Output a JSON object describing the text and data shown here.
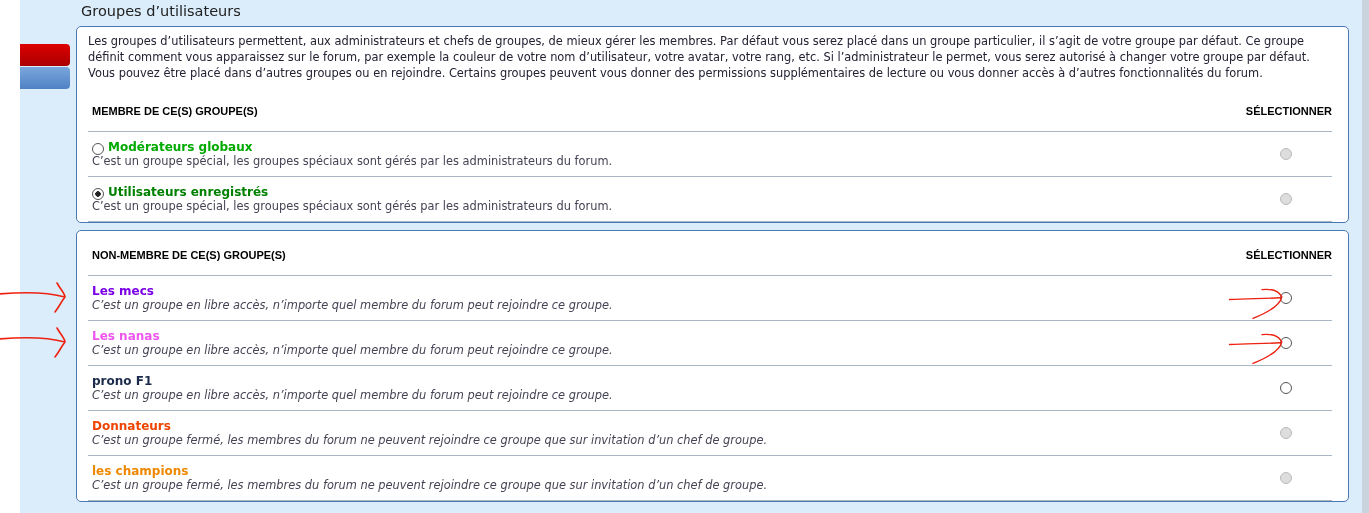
{
  "title": "Groupes d’utilisateurs",
  "intro": "Les groupes d’utilisateurs permettent, aux administrateurs et chefs de groupes, de mieux gérer les membres. Par défaut vous serez placé dans un groupe particulier, il s’agit de votre groupe par défaut. Ce groupe définit comment vous apparaissez sur le forum, par exemple la couleur de votre nom d’utilisateur, votre avatar, votre rang, etc. Si l’administrateur le permet, vous serez autorisé à changer votre groupe par défaut. Vous pouvez être placé dans d’autres groupes ou en rejoindre. Certains groupes peuvent vous donner des permissions supplémentaires de lecture ou vous donner accès à d’autres fonctionnalités du forum.",
  "sections": [
    {
      "heading": "MEMBRE DE CE(S) GROUPE(S)",
      "select_heading": "SÉLECTIONNER",
      "groups": [
        {
          "name": "Modérateurs globaux",
          "color": "#00aa00",
          "description": "C’est un groupe spécial, les groupes spéciaux sont gérés par les administrateurs du forum.",
          "kind": "member",
          "default": false,
          "select_disabled": true,
          "marked": false
        },
        {
          "name": "Utilisateurs enregistrés",
          "color": "#008000",
          "description": "C’est un groupe spécial, les groupes spéciaux sont gérés par les administrateurs du forum.",
          "kind": "member",
          "default": true,
          "select_disabled": true,
          "marked": false
        }
      ]
    },
    {
      "heading": "NON-MEMBRE DE CE(S) GROUPE(S)",
      "select_heading": "SÉLECTIONNER",
      "groups": [
        {
          "name": "Les mecs",
          "color": "#7a00e6",
          "description": "C’est un groupe en libre accès, n’importe quel membre du forum peut rejoindre ce groupe.",
          "kind": "other",
          "select_disabled": false,
          "marked": true
        },
        {
          "name": "Les nanas",
          "color": "#ee55ee",
          "description": "C’est un groupe en libre accès, n’importe quel membre du forum peut rejoindre ce groupe.",
          "kind": "other",
          "select_disabled": false,
          "marked": true
        },
        {
          "name": "prono F1",
          "color": "#1a2a4a",
          "description": "C’est un groupe en libre accès, n’importe quel membre du forum peut rejoindre ce groupe.",
          "kind": "other",
          "select_disabled": false,
          "marked": false
        },
        {
          "name": "Donnateurs",
          "color": "#ee4400",
          "description": "C’est un groupe fermé, les membres du forum ne peuvent rejoindre ce groupe que sur invitation d’un chef de groupe.",
          "kind": "other",
          "select_disabled": true,
          "marked": false
        },
        {
          "name": "les champions",
          "color": "#ee8800",
          "description": "C’est un groupe fermé, les membres du forum ne peuvent rejoindre ce groupe que sur invitation d’un chef de groupe.",
          "kind": "other",
          "select_disabled": true,
          "marked": false
        }
      ]
    }
  ]
}
